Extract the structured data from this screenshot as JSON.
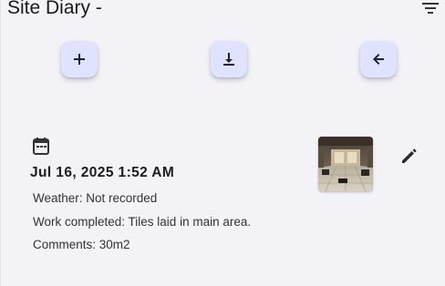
{
  "header": {
    "title": "Site Diary -",
    "filter_icon": "filter-list-icon"
  },
  "actions": {
    "add_icon": "plus-icon",
    "download_icon": "download-icon",
    "back_icon": "arrow-left-icon",
    "fab_color": "#dfe3ff",
    "icon_color": "#1b1f3b"
  },
  "entries": [
    {
      "date": "Jul 16, 2025 1:52 AM",
      "weather": "Weather: Not recorded",
      "work_completed": "Work completed: Tiles laid in main area.",
      "comments": "Comments: 30m2",
      "calendar_icon": "calendar-icon",
      "edit_icon": "pencil-icon",
      "photo": "interior-room-photo"
    }
  ],
  "colors": {
    "background": "#f3f3f7",
    "text": "#111111"
  }
}
